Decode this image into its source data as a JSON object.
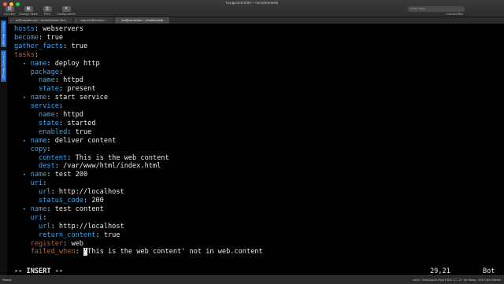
{
  "window": {
    "title": "lux@controller:~/ansible/web"
  },
  "toolbar": {
    "buttons": [
      {
        "label": "Connect",
        "icon": "link-icon"
      },
      {
        "label": "Change State",
        "icon": "grid-icon"
      },
      {
        "label": "Print",
        "icon": "print-icon"
      },
      {
        "label": "Configuration",
        "icon": "tools-icon"
      }
    ],
    "search_placeholder": "Enter Host",
    "connect_bar": "Connect Bar"
  },
  "tabs": [
    {
      "label": "pi@raspberrypi:~/ansible/web.html"
    },
    {
      "label": "vagrant@stream:~"
    },
    {
      "label": "lux@controller:~/ansible/web"
    }
  ],
  "sidebar": {
    "session_manager": "Session Manager",
    "command_manager": "Command Manager"
  },
  "editor": {
    "lines": [
      [
        {
          "c": "blue",
          "t": "hosts"
        },
        {
          "c": "white",
          "t": ": webservers"
        }
      ],
      [
        {
          "c": "blue",
          "t": "become"
        },
        {
          "c": "white",
          "t": ": true"
        }
      ],
      [
        {
          "c": "blue",
          "t": "gather_facts"
        },
        {
          "c": "white",
          "t": ": true"
        }
      ],
      [
        {
          "c": "red",
          "t": "tasks"
        },
        {
          "c": "white",
          "t": ":"
        }
      ],
      [
        {
          "c": "white",
          "t": "  - "
        },
        {
          "c": "blue",
          "t": "name"
        },
        {
          "c": "white",
          "t": ": deploy http"
        }
      ],
      [
        {
          "c": "white",
          "t": "    "
        },
        {
          "c": "blue",
          "t": "package"
        },
        {
          "c": "white",
          "t": ":"
        }
      ],
      [
        {
          "c": "white",
          "t": "      "
        },
        {
          "c": "blue",
          "t": "name"
        },
        {
          "c": "white",
          "t": ": httpd"
        }
      ],
      [
        {
          "c": "white",
          "t": "      "
        },
        {
          "c": "blue",
          "t": "state"
        },
        {
          "c": "white",
          "t": ": present"
        }
      ],
      [
        {
          "c": "white",
          "t": "  - "
        },
        {
          "c": "blue",
          "t": "name"
        },
        {
          "c": "white",
          "t": ": start service"
        }
      ],
      [
        {
          "c": "white",
          "t": "    "
        },
        {
          "c": "blue",
          "t": "service"
        },
        {
          "c": "white",
          "t": ":"
        }
      ],
      [
        {
          "c": "white",
          "t": "      "
        },
        {
          "c": "blue",
          "t": "name"
        },
        {
          "c": "white",
          "t": ": httpd"
        }
      ],
      [
        {
          "c": "white",
          "t": "      "
        },
        {
          "c": "blue",
          "t": "state"
        },
        {
          "c": "white",
          "t": ": started"
        }
      ],
      [
        {
          "c": "white",
          "t": "      "
        },
        {
          "c": "blue",
          "t": "enabled"
        },
        {
          "c": "white",
          "t": ": true"
        }
      ],
      [
        {
          "c": "white",
          "t": "  - "
        },
        {
          "c": "blue",
          "t": "name"
        },
        {
          "c": "white",
          "t": ": deliver content"
        }
      ],
      [
        {
          "c": "white",
          "t": "    "
        },
        {
          "c": "blue",
          "t": "copy"
        },
        {
          "c": "white",
          "t": ":"
        }
      ],
      [
        {
          "c": "white",
          "t": "      "
        },
        {
          "c": "blue",
          "t": "content"
        },
        {
          "c": "white",
          "t": ": This is the web content"
        }
      ],
      [
        {
          "c": "white",
          "t": "      "
        },
        {
          "c": "blue",
          "t": "dest"
        },
        {
          "c": "white",
          "t": ": /var/www/html/index.html"
        }
      ],
      [
        {
          "c": "white",
          "t": "  - "
        },
        {
          "c": "blue",
          "t": "name"
        },
        {
          "c": "white",
          "t": ": test 200"
        }
      ],
      [
        {
          "c": "white",
          "t": "    "
        },
        {
          "c": "blue",
          "t": "uri"
        },
        {
          "c": "white",
          "t": ":"
        }
      ],
      [
        {
          "c": "white",
          "t": "      "
        },
        {
          "c": "blue",
          "t": "url"
        },
        {
          "c": "white",
          "t": ": http://localhost"
        }
      ],
      [
        {
          "c": "white",
          "t": "      "
        },
        {
          "c": "blue",
          "t": "status_code"
        },
        {
          "c": "white",
          "t": ": 200"
        }
      ],
      [
        {
          "c": "white",
          "t": "  - "
        },
        {
          "c": "blue",
          "t": "name"
        },
        {
          "c": "white",
          "t": ": test content"
        }
      ],
      [
        {
          "c": "white",
          "t": "    "
        },
        {
          "c": "blue",
          "t": "uri"
        },
        {
          "c": "white",
          "t": ":"
        }
      ],
      [
        {
          "c": "white",
          "t": "      "
        },
        {
          "c": "blue",
          "t": "url"
        },
        {
          "c": "white",
          "t": ": http://localhost"
        }
      ],
      [
        {
          "c": "white",
          "t": "      "
        },
        {
          "c": "blue",
          "t": "return_content"
        },
        {
          "c": "white",
          "t": ": true"
        }
      ],
      [
        {
          "c": "white",
          "t": "    "
        },
        {
          "c": "red",
          "t": "register"
        },
        {
          "c": "white",
          "t": ": web"
        }
      ],
      [
        {
          "c": "white",
          "t": "    "
        },
        {
          "c": "red",
          "t": "failed_when"
        },
        {
          "c": "white",
          "t": ": "
        },
        {
          "c": "cursor",
          "t": "'"
        },
        {
          "c": "white",
          "t": "This is the web content' not in web.content"
        }
      ]
    ],
    "mode": "-- INSERT --",
    "position": "29,21",
    "scroll": "Bot"
  },
  "statusbar": {
    "ready": "Ready",
    "session": "ssh2: ChaCha20-Poly1305   27, 21   30 Rows, 104 Cols   Xterm"
  },
  "colors": {
    "key_blue": "#3ea6e8",
    "key_red": "#d05a2c",
    "text": "#e8e8e8",
    "background": "#000000",
    "sidebar_accent": "#1e64c8"
  }
}
